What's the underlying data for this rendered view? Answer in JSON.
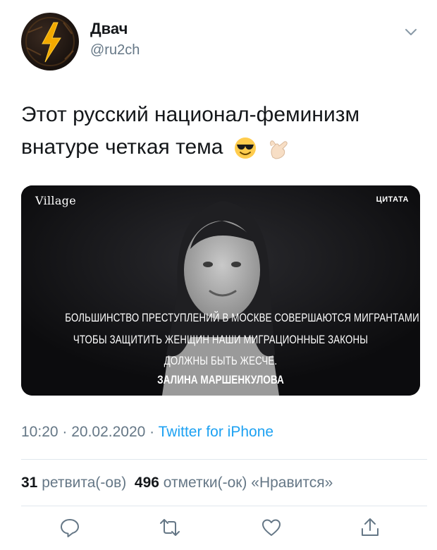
{
  "header": {
    "name": "Двач",
    "handle": "@ru2ch",
    "avatar_icon": "lightning-bolt-avatar",
    "menu_icon": "chevron-down-icon"
  },
  "tweet": {
    "line1": "Этот русский национал-феминизм",
    "line2": "внатуре четкая тема",
    "emojis": [
      "smiling-face-with-sunglasses-emoji",
      "call-me-hand-emoji"
    ]
  },
  "media": {
    "brand": "Village",
    "badge": "ЦИТАТА",
    "quote_line1": "БОЛЬШИНСТВО ПРЕСТУПЛЕНИЙ В МОСКВЕ СОВЕРШАЮТСЯ МИГРАНТАМИ.",
    "quote_line2": "ЧТОБЫ ЗАЩИТИТЬ ЖЕНЩИН НАШИ МИГРАЦИОННЫЕ ЗАКОНЫ",
    "quote_line3": "ДОЛЖНЫ БЫТЬ ЖЕСЧЕ.",
    "author": "ЗАЛИНА МАРШЕНКУЛОВА"
  },
  "meta": {
    "time": "10:20",
    "sep1": " · ",
    "date": "20.02.2020",
    "sep2": " · ",
    "source": "Twitter for iPhone"
  },
  "stats": {
    "retweets_count": "31",
    "retweets_label": " ретвита(-ов)  ",
    "likes_count": "496",
    "likes_label": " отметки(-ок) «Нравится»"
  },
  "actions": [
    "reply-icon",
    "retweet-icon",
    "like-icon",
    "share-icon"
  ],
  "colors": {
    "accent": "#1da1f2",
    "secondary_text": "#657786",
    "divider": "#e1e8ed"
  }
}
